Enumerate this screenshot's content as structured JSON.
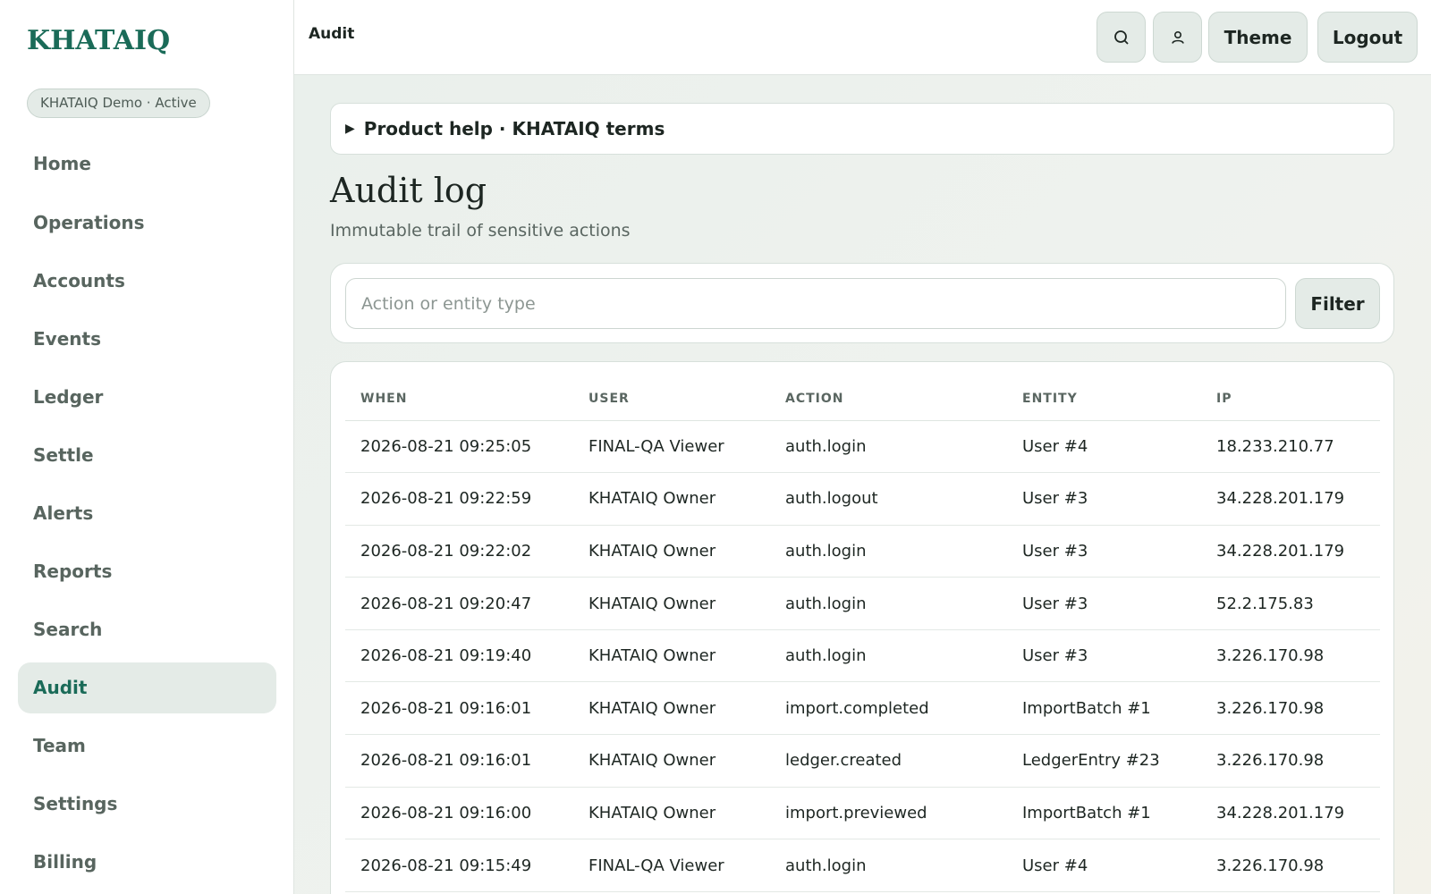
{
  "brand": "KHATAIQ",
  "org_pill": "KHATAIQ Demo · Active",
  "nav": [
    {
      "label": "Home"
    },
    {
      "label": "Operations"
    },
    {
      "label": "Accounts"
    },
    {
      "label": "Events"
    },
    {
      "label": "Ledger"
    },
    {
      "label": "Settle"
    },
    {
      "label": "Alerts"
    },
    {
      "label": "Reports"
    },
    {
      "label": "Search"
    },
    {
      "label": "Audit",
      "active": true
    },
    {
      "label": "Team"
    },
    {
      "label": "Settings"
    },
    {
      "label": "Billing"
    }
  ],
  "topbar": {
    "crumb": "Audit",
    "search_icon": "search-icon",
    "user_icon": "user-icon",
    "theme_label": "Theme",
    "logout_label": "Logout"
  },
  "help": {
    "label": "Product help · KHATAIQ terms"
  },
  "page": {
    "title": "Audit log",
    "subtitle": "Immutable trail of sensitive actions"
  },
  "filter": {
    "placeholder": "Action or entity type",
    "value": "",
    "button_label": "Filter"
  },
  "table": {
    "headers": [
      "WHEN",
      "USER",
      "ACTION",
      "ENTITY",
      "IP"
    ],
    "rows": [
      [
        "2026-08-21 09:25:05",
        "FINAL-QA Viewer",
        "auth.login",
        "User #4",
        "18.233.210.77"
      ],
      [
        "2026-08-21 09:22:59",
        "KHATAIQ Owner",
        "auth.logout",
        "User #3",
        "34.228.201.179"
      ],
      [
        "2026-08-21 09:22:02",
        "KHATAIQ Owner",
        "auth.login",
        "User #3",
        "34.228.201.179"
      ],
      [
        "2026-08-21 09:20:47",
        "KHATAIQ Owner",
        "auth.login",
        "User #3",
        "52.2.175.83"
      ],
      [
        "2026-08-21 09:19:40",
        "KHATAIQ Owner",
        "auth.login",
        "User #3",
        "3.226.170.98"
      ],
      [
        "2026-08-21 09:16:01",
        "KHATAIQ Owner",
        "import.completed",
        "ImportBatch #1",
        "3.226.170.98"
      ],
      [
        "2026-08-21 09:16:01",
        "KHATAIQ Owner",
        "ledger.created",
        "LedgerEntry #23",
        "3.226.170.98"
      ],
      [
        "2026-08-21 09:16:00",
        "KHATAIQ Owner",
        "import.previewed",
        "ImportBatch #1",
        "34.228.201.179"
      ],
      [
        "2026-08-21 09:15:49",
        "FINAL-QA Viewer",
        "auth.login",
        "User #4",
        "3.226.170.98"
      ]
    ]
  },
  "colors": {
    "brand": "#1a6b58",
    "active_nav_bg": "#e4ebe7",
    "button_bg": "#e4ebe7"
  }
}
